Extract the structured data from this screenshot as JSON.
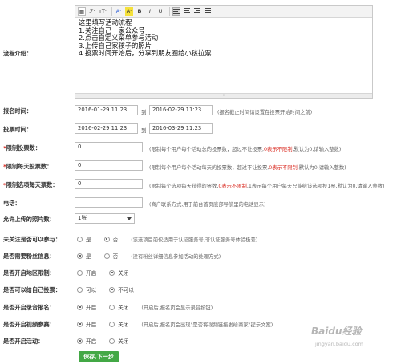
{
  "intro": {
    "label": "流程介绍：",
    "editor_lines": [
      "这里填写活动流程",
      "1.关注自己一家公众号",
      "2.点击自定义菜单参与活动",
      "3.上传自己家孩子的照片",
      "4.投票时间开始后，分享到朋友圈给小孩拉票"
    ],
    "toolbar": {
      "font": "ℱ·",
      "size": "тT·",
      "fontcolor": "A·",
      "hilite": "A·",
      "bold": "B",
      "italic": "I",
      "underline": "U",
      "handle": "·:·"
    }
  },
  "signup_time": {
    "label": "报名时间：",
    "start": "2016-01-29 11:23",
    "sep": "到",
    "end": "2016-02-29 11:23",
    "hint": "(报名截止时间请设置在投票开始时间之前)"
  },
  "vote_time": {
    "label": "投票时间：",
    "start": "2016-02-29 11:23",
    "sep": "到",
    "end": "2016-03-29 11:23"
  },
  "limit_total": {
    "star": "*",
    "label": "限制投票数：",
    "value": "0",
    "hint_a": "(限制每个用户每个活动总的投票数，超过不让投票,",
    "hint_red": "0表示不限制",
    "hint_b": ",默认为0,请输入整数)"
  },
  "limit_daily": {
    "star": "*",
    "label": "限制每天投票数：",
    "value": "0",
    "hint_a": "(限制每个用户每个活动每天的投票数，超过不让投票,",
    "hint_red": "0表示不限制",
    "hint_b": ",默认为0,请输入整数)"
  },
  "limit_option": {
    "star": "*",
    "label": "限制选项每天票数：",
    "value": "0",
    "hint_a": "(限制每个选项每天获得的票数,",
    "hint_red": "0表示不限制",
    "hint_b": ",1表示每个用户每天只能给该选项投1票,默认为0,请输入整数)"
  },
  "phone": {
    "label": "电话：",
    "value": "",
    "hint": "(商户联系方式,用于前台首页底部导航里的电话显示)"
  },
  "photos": {
    "label": "允许上传的照片数：",
    "selected": "1张"
  },
  "auth": {
    "label": "未关注是否可以参与：",
    "opt1": "是",
    "opt2": "否",
    "selected": 2,
    "hint": "(该选项目前仅适用于认证服务号,非认证服务号体验极差)"
  },
  "fans": {
    "label": "是否需要粉丝信息：",
    "opt1": "是",
    "opt2": "否",
    "selected": 1,
    "hint": "(没有粉丝详细信息参加活动的处理方式)"
  },
  "region": {
    "label": "是否开启地区限制：",
    "opt1": "开启",
    "opt2": "关闭",
    "selected": 2
  },
  "self_vote": {
    "label": "是否可以给自己投票：",
    "opt1": "可以",
    "opt2": "不可以",
    "selected": 2
  },
  "enroll": {
    "label": "是否开启录音报名：",
    "opt1": "开启",
    "opt2": "关闭",
    "selected": 1,
    "hint": "(开启后,报名页会显示录音按钮)"
  },
  "video": {
    "label": "是否开启视频参赛：",
    "opt1": "开启",
    "opt2": "关闭",
    "selected": 1,
    "hint": "(开启后,报名页会出现\"是否将视频链接发给商家\"提示文案)"
  },
  "activity": {
    "label": "是否开启活动：",
    "opt1": "开启",
    "opt2": "关闭",
    "selected": 1
  },
  "submit": {
    "label": "保存,下一步"
  },
  "watermark": {
    "main": "Baidu经验",
    "sub": "jingyan.baidu.com"
  }
}
